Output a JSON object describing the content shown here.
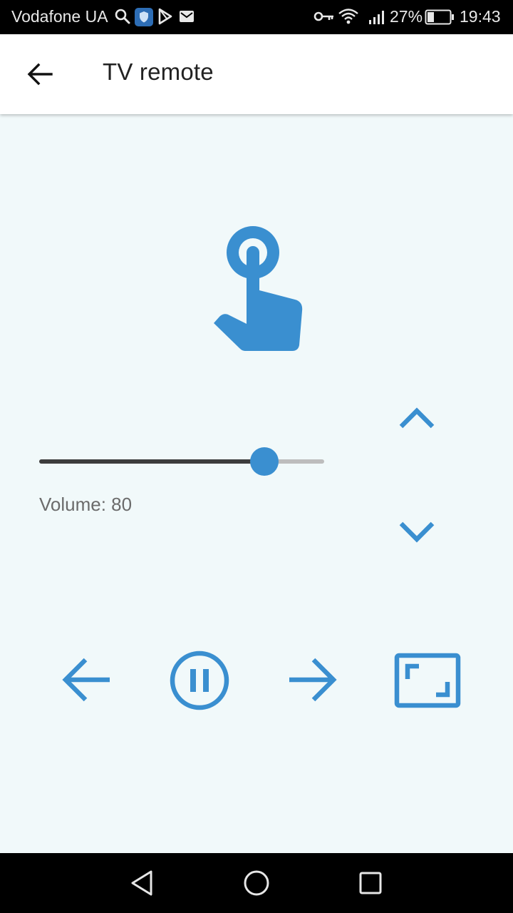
{
  "status_bar": {
    "carrier": "Vodafone UA",
    "battery": "27%",
    "time": "19:43",
    "icons": [
      "search-icon",
      "shield-icon",
      "play-store-icon",
      "mail-icon",
      "key-icon",
      "wifi-icon",
      "signal-icon",
      "battery-icon"
    ]
  },
  "app_bar": {
    "title": "TV remote",
    "back_icon": "arrow-left-icon"
  },
  "remote": {
    "touchpad_icon": "touch-hand-icon",
    "volume": {
      "label": "Volume: 80",
      "level": 0.77
    },
    "channel": {
      "up_icon": "chevron-up-icon",
      "down_icon": "chevron-down-icon"
    },
    "controls": [
      {
        "name": "previous",
        "icon": "arrow-left-icon"
      },
      {
        "name": "pause",
        "icon": "pause-circle-icon"
      },
      {
        "name": "next",
        "icon": "arrow-right-icon"
      },
      {
        "name": "fullscreen",
        "icon": "aspect-ratio-icon"
      }
    ]
  },
  "colors": {
    "accent": "#3a8fd0",
    "background": "#f1f9fa",
    "app_bar": "#ffffff",
    "status_bar": "#000000"
  },
  "nav_bar": {
    "icons": [
      "back-triangle-icon",
      "home-circle-icon",
      "recents-square-icon"
    ]
  }
}
